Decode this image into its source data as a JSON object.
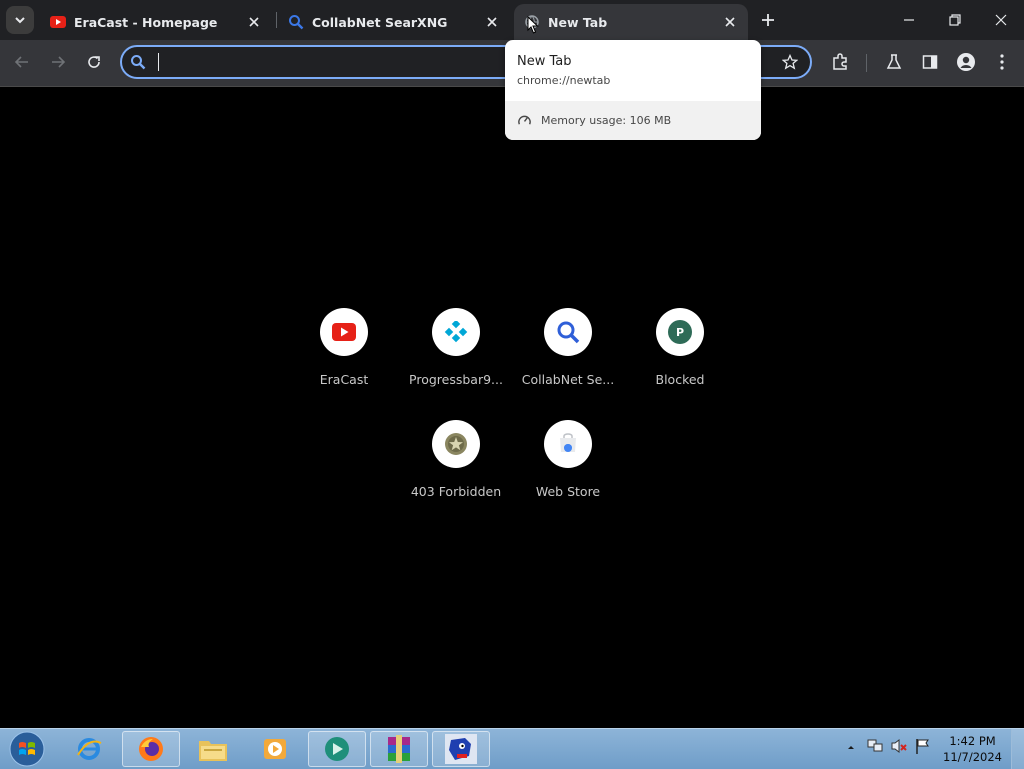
{
  "tabs": [
    {
      "title": "EraCast - Homepage",
      "favicon": "youtube-icon"
    },
    {
      "title": "CollabNet SearXNG",
      "favicon": "search-icon"
    },
    {
      "title": "New Tab",
      "favicon": "globe-icon",
      "active": true
    }
  ],
  "omnibox": {
    "value": "",
    "placeholder": ""
  },
  "hover_card": {
    "title": "New Tab",
    "url": "chrome://newtab",
    "memory": "Memory usage: 106 MB"
  },
  "shortcuts": [
    {
      "label": "EraCast",
      "icon": "youtube-icon"
    },
    {
      "label": "Progressbar9...",
      "icon": "progressbar-icon"
    },
    {
      "label": "CollabNet Se...",
      "icon": "search-icon"
    },
    {
      "label": "Blocked",
      "icon": "letter-p-icon"
    },
    {
      "label": "403 Forbidden",
      "icon": "star-badge-icon"
    },
    {
      "label": "Web Store",
      "icon": "web-store-icon"
    }
  ],
  "taskbar": {
    "apps": [
      "internet-explorer-icon",
      "firefox-icon",
      "file-explorer-icon",
      "media-player-icon",
      "remote-desktop-icon",
      "winrar-icon",
      "sonic-icon"
    ],
    "clock_time": "1:42 PM",
    "clock_date": "11/7/2024"
  },
  "colors": {
    "tabstrip": "#202124",
    "toolbar": "#35363a",
    "omnibox_border": "#7cacf8",
    "youtube_red": "#e62117",
    "search_blue": "#2f5fd8",
    "teal": "#00a7d6",
    "blocked_green": "#2e6b57"
  }
}
